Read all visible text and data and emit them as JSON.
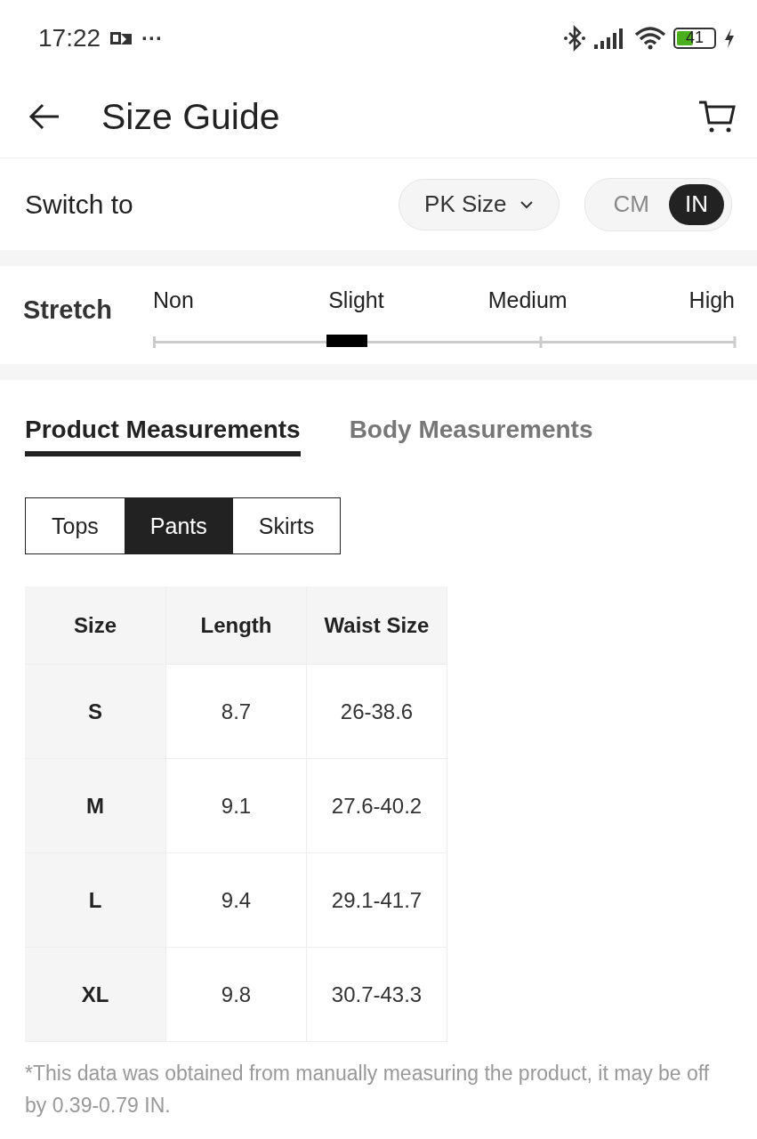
{
  "status_bar": {
    "time": "17:22",
    "more": "···",
    "battery": "41"
  },
  "header": {
    "title": "Size Guide"
  },
  "switch_row": {
    "label": "Switch to",
    "size_system": "PK Size",
    "units": [
      {
        "label": "CM",
        "selected": false
      },
      {
        "label": "IN",
        "selected": true
      }
    ]
  },
  "stretch": {
    "label": "Stretch",
    "levels": [
      {
        "label": "Non",
        "selected": false
      },
      {
        "label": "Slight",
        "selected": true
      },
      {
        "label": "Medium",
        "selected": false
      },
      {
        "label": "High",
        "selected": false
      }
    ]
  },
  "measurement_tabs": [
    {
      "label": "Product Measurements",
      "selected": true
    },
    {
      "label": "Body Measurements",
      "selected": false
    }
  ],
  "category_tabs": [
    {
      "label": "Tops",
      "selected": false
    },
    {
      "label": "Pants",
      "selected": true
    },
    {
      "label": "Skirts",
      "selected": false
    }
  ],
  "table": {
    "columns": [
      "Size",
      "Length",
      "Waist Size"
    ],
    "rows": [
      [
        "S",
        "8.7",
        "26-38.6"
      ],
      [
        "M",
        "9.1",
        "27.6-40.2"
      ],
      [
        "L",
        "9.4",
        "29.1-41.7"
      ],
      [
        "XL",
        "9.8",
        "30.7-43.3"
      ]
    ]
  },
  "note": "*This data was obtained from manually measuring the product, it may be off by 0.39-0.79 IN."
}
